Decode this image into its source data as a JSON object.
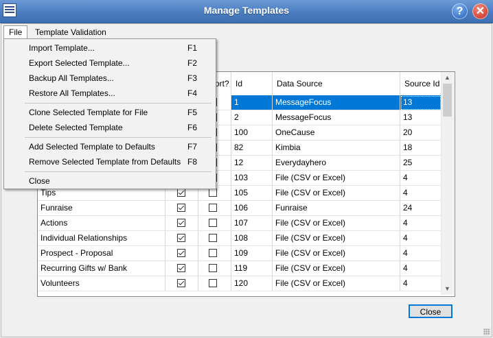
{
  "window": {
    "title": "Manage Templates",
    "help_icon": "?",
    "close_icon": "✕"
  },
  "menubar": [
    {
      "label": "File"
    },
    {
      "label": "Template Validation"
    }
  ],
  "file_menu": {
    "items": [
      {
        "label": "Import Template...",
        "shortcut": "F1"
      },
      {
        "label": "Export Selected Template...",
        "shortcut": "F2"
      },
      {
        "label": "Backup All Templates...",
        "shortcut": "F3"
      },
      {
        "label": "Restore All Templates...",
        "shortcut": "F4"
      },
      {
        "label": "Clone Selected Template for File",
        "shortcut": "F5"
      },
      {
        "label": "Delete Selected Template",
        "shortcut": "F6"
      },
      {
        "label": "Add Selected Template to Defaults",
        "shortcut": "F7"
      },
      {
        "label": "Remove Selected Template from Defaults",
        "shortcut": "F8"
      },
      {
        "label": "Close",
        "shortcut": ""
      }
    ]
  },
  "grid": {
    "columns": [
      "",
      "",
      "ort?",
      "Id",
      "Data Source",
      "Source Id"
    ],
    "rows": [
      {
        "name": "",
        "default": true,
        "import": false,
        "id": "1",
        "source": "MessageFocus",
        "source_id": "13",
        "selected": true
      },
      {
        "name": "",
        "default": true,
        "import": false,
        "id": "2",
        "source": "MessageFocus",
        "source_id": "13"
      },
      {
        "name": "",
        "default": true,
        "import": false,
        "id": "100",
        "source": "OneCause",
        "source_id": "20"
      },
      {
        "name": "",
        "default": true,
        "import": false,
        "id": "82",
        "source": "Kimbia",
        "source_id": "18"
      },
      {
        "name": "",
        "default": true,
        "import": false,
        "id": "12",
        "source": "Everydayhero",
        "source_id": "25"
      },
      {
        "name": "",
        "default": true,
        "import": false,
        "id": "103",
        "source": "File (CSV or Excel)",
        "source_id": "4"
      },
      {
        "name": "Tips",
        "default": true,
        "import": false,
        "id": "105",
        "source": "File (CSV or Excel)",
        "source_id": "4"
      },
      {
        "name": "Funraise",
        "default": true,
        "import": false,
        "id": "106",
        "source": "Funraise",
        "source_id": "24"
      },
      {
        "name": "Actions",
        "default": true,
        "import": false,
        "id": "107",
        "source": "File (CSV or Excel)",
        "source_id": "4"
      },
      {
        "name": "Individual Relationships",
        "default": true,
        "import": false,
        "id": "108",
        "source": "File (CSV or Excel)",
        "source_id": "4"
      },
      {
        "name": "Prospect - Proposal",
        "default": true,
        "import": false,
        "id": "109",
        "source": "File (CSV or Excel)",
        "source_id": "4"
      },
      {
        "name": "Recurring Gifts w/ Bank",
        "default": true,
        "import": false,
        "id": "119",
        "source": "File (CSV or Excel)",
        "source_id": "4"
      },
      {
        "name": "Volunteers",
        "default": true,
        "import": false,
        "id": "120",
        "source": "File (CSV or Excel)",
        "source_id": "4"
      }
    ]
  },
  "scrollbar": {
    "up_arrow": "▲",
    "down_arrow": "▼"
  },
  "buttons": {
    "close": "Close"
  }
}
